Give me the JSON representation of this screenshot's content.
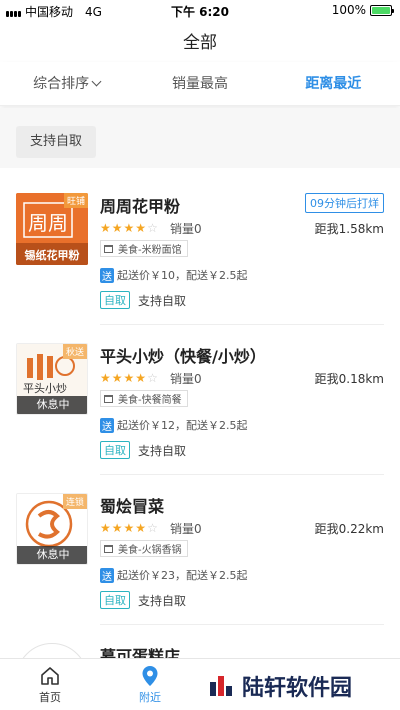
{
  "status_bar": {
    "carrier": "中国移动",
    "network": "4G",
    "time": "下午 6:20",
    "battery": "100%"
  },
  "header": {
    "title": "全部"
  },
  "sort_tabs": [
    {
      "label": "综合排序"
    },
    {
      "label": "销量最高"
    },
    {
      "label": "距离最近",
      "active": true
    }
  ],
  "filter": {
    "chip": "支持自取"
  },
  "stores": [
    {
      "name": "周周花甲粉",
      "thumb_text": "周周",
      "thumb_caption": "锡纸花甲粉",
      "thumb_corner": "旺铺",
      "rating": 4,
      "sales": "销量0",
      "distance": "距我1.58km",
      "time_badge": "09分钟后打烊",
      "category": "美食-米粉面馆",
      "send_tag": "送",
      "delivery": "起送价￥10，配送￥2.5起",
      "pickup_tag": "自取",
      "pickup": "支持自取"
    },
    {
      "name": "平头小炒（快餐/小炒）",
      "thumb_text": "平头小炒",
      "thumb_corner": "秋送",
      "rest_tag": "休息中",
      "rating": 4,
      "sales": "销量0",
      "distance": "距我0.18km",
      "category": "美食-快餐简餐",
      "send_tag": "送",
      "delivery": "起送价￥12，配送￥2.5起",
      "pickup_tag": "自取",
      "pickup": "支持自取"
    },
    {
      "name": "蜀烩冒菜",
      "thumb_corner": "连锁",
      "rest_tag": "休息中",
      "rating": 4,
      "sales": "销量0",
      "distance": "距我0.22km",
      "category": "美食-火锅香锅",
      "send_tag": "送",
      "delivery": "起送价￥23，配送￥2.5起",
      "pickup_tag": "自取",
      "pickup": "支持自取"
    },
    {
      "name": "慕可蛋糕店"
    }
  ],
  "tab_bar": [
    {
      "label": "首页",
      "icon": "home-icon"
    },
    {
      "label": "附近",
      "icon": "location-pin-icon",
      "active": true
    }
  ],
  "watermark": {
    "text": "陆轩软件园"
  },
  "colors": {
    "accent": "#2f8fe6",
    "star": "#f5a623",
    "pickup": "#2bb3c0"
  }
}
